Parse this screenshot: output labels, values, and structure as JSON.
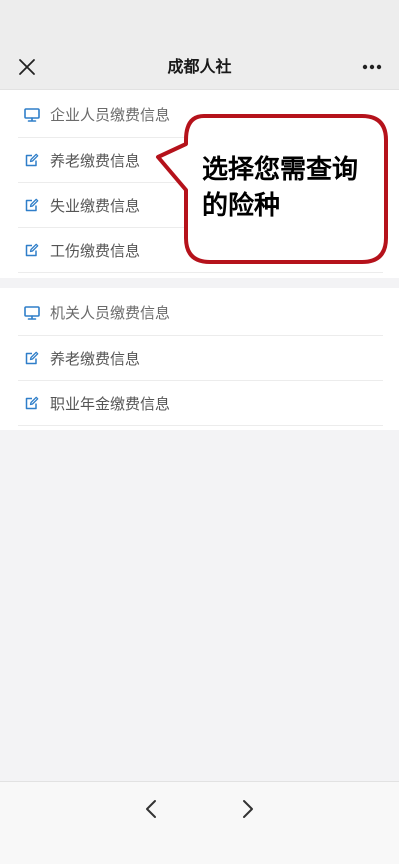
{
  "header": {
    "title": "成都人社",
    "close_icon": "close-icon",
    "more_icon": "more-icon"
  },
  "sections": [
    {
      "header_label": "企业人员缴费信息",
      "header_icon": "monitor-icon",
      "items": [
        {
          "label": "养老缴费信息",
          "icon": "edit-note-icon"
        },
        {
          "label": "失业缴费信息",
          "icon": "edit-note-icon"
        },
        {
          "label": "工伤缴费信息",
          "icon": "edit-note-icon"
        }
      ]
    },
    {
      "header_label": "机关人员缴费信息",
      "header_icon": "monitor-icon",
      "items": [
        {
          "label": "养老缴费信息",
          "icon": "edit-note-icon"
        },
        {
          "label": "职业年金缴费信息",
          "icon": "edit-note-icon"
        }
      ]
    }
  ],
  "callout": {
    "text": "选择您需查询的险种"
  },
  "bottom_nav": {
    "back_icon": "chevron-left-icon",
    "forward_icon": "chevron-right-icon"
  },
  "colors": {
    "accent": "#2f7ec9",
    "callout_border": "#b5121b",
    "bar_bg": "#ededed"
  }
}
